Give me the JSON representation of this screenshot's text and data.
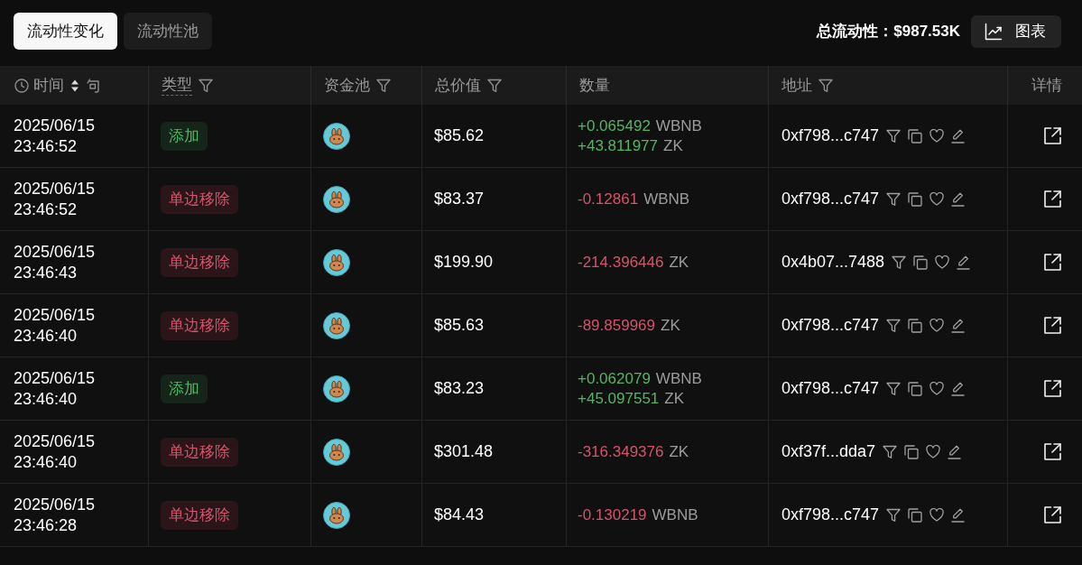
{
  "tabs": [
    {
      "label": "流动性变化",
      "selected": true
    },
    {
      "label": "流动性池",
      "selected": false
    }
  ],
  "total_liquidity": "总流动性：$987.53K",
  "chart_button": {
    "label": "图表"
  },
  "table": {
    "columns": [
      {
        "label": "时间",
        "kind": "time",
        "filter": false
      },
      {
        "label": "类型",
        "kind": "hint",
        "filter": true
      },
      {
        "label": "资金池",
        "kind": "plain",
        "filter": true
      },
      {
        "label": "总价值",
        "kind": "plain",
        "filter": true
      },
      {
        "label": "数量",
        "kind": "plain",
        "filter": false
      },
      {
        "label": "地址",
        "kind": "plain",
        "filter": true
      },
      {
        "label": "详情",
        "kind": "plain",
        "filter": false
      }
    ],
    "rows": [
      {
        "date": "2025/06/15",
        "time": "23:46:52",
        "type": {
          "kind": "add",
          "label": "添加"
        },
        "value": "$85.62",
        "amounts": [
          {
            "value": "+0.065492",
            "token": "WBNB"
          },
          {
            "value": "+43.811977",
            "token": "ZK"
          }
        ],
        "address": "0xf798...c747"
      },
      {
        "date": "2025/06/15",
        "time": "23:46:52",
        "type": {
          "kind": "remove",
          "label": "单边移除"
        },
        "value": "$83.37",
        "amounts": [
          {
            "value": "-0.12861",
            "token": "WBNB"
          }
        ],
        "address": "0xf798...c747"
      },
      {
        "date": "2025/06/15",
        "time": "23:46:43",
        "type": {
          "kind": "remove",
          "label": "单边移除"
        },
        "value": "$199.90",
        "amounts": [
          {
            "value": "-214.396446",
            "token": "ZK"
          }
        ],
        "address": "0x4b07...7488"
      },
      {
        "date": "2025/06/15",
        "time": "23:46:40",
        "type": {
          "kind": "remove",
          "label": "单边移除"
        },
        "value": "$85.63",
        "amounts": [
          {
            "value": "-89.859969",
            "token": "ZK"
          }
        ],
        "address": "0xf798...c747"
      },
      {
        "date": "2025/06/15",
        "time": "23:46:40",
        "type": {
          "kind": "add",
          "label": "添加"
        },
        "value": "$83.23",
        "amounts": [
          {
            "value": "+0.062079",
            "token": "WBNB"
          },
          {
            "value": "+45.097551",
            "token": "ZK"
          }
        ],
        "address": "0xf798...c747"
      },
      {
        "date": "2025/06/15",
        "time": "23:46:40",
        "type": {
          "kind": "remove",
          "label": "单边移除"
        },
        "value": "$301.48",
        "amounts": [
          {
            "value": "-316.349376",
            "token": "ZK"
          }
        ],
        "address": "0xf37f...dda7"
      },
      {
        "date": "2025/06/15",
        "time": "23:46:28",
        "type": {
          "kind": "remove",
          "label": "单边移除"
        },
        "value": "$84.43",
        "amounts": [
          {
            "value": "-0.130219",
            "token": "WBNB"
          }
        ],
        "address": "0xf798...c747"
      }
    ]
  }
}
